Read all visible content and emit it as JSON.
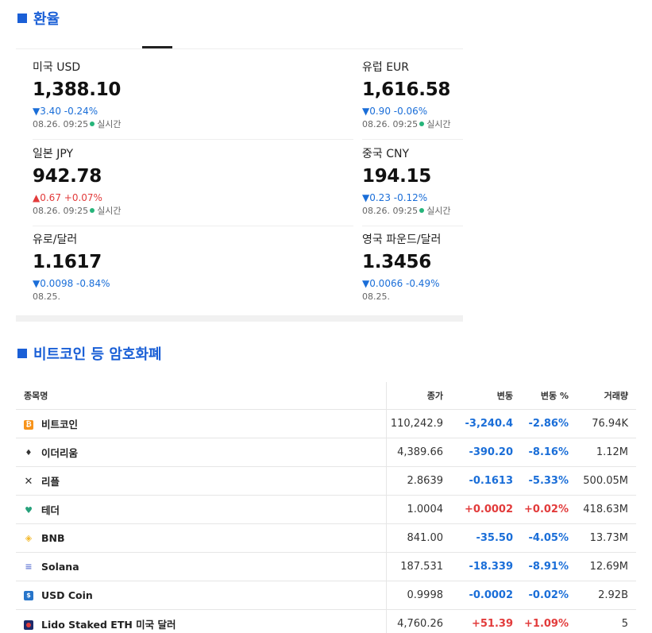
{
  "fx_section": {
    "title": "환율"
  },
  "fx_items": [
    {
      "name": "미국 USD",
      "price": "1,388.10",
      "change": "▼3.40  -0.24%",
      "direction": "down",
      "date": "08.26. 09:25",
      "live": "실시간"
    },
    {
      "name": "유럽 EUR",
      "price": "1,616.58",
      "change": "▼0.90  -0.06%",
      "direction": "down",
      "date": "08.26. 09:25",
      "live": "실시간"
    },
    {
      "name": "일본 JPY",
      "price": "942.78",
      "change": "▲0.67  +0.07%",
      "direction": "up",
      "date": "08.26. 09:25",
      "live": "실시간"
    },
    {
      "name": "중국 CNY",
      "price": "194.15",
      "change": "▼0.23  -0.12%",
      "direction": "down",
      "date": "08.26. 09:25",
      "live": "실시간"
    },
    {
      "name": "유로/달러",
      "price": "1.1617",
      "change": "▼0.0098  -0.84%",
      "direction": "down",
      "date": "08.25.",
      "live": ""
    },
    {
      "name": "영국 파운드/달러",
      "price": "1.3456",
      "change": "▼0.0066  -0.49%",
      "direction": "down",
      "date": "08.25.",
      "live": ""
    }
  ],
  "crypto_section": {
    "title": "비트코인 등 암호화폐"
  },
  "crypto_table": {
    "headers": {
      "name": "종목명",
      "price": "종가",
      "change": "변동",
      "change_pct": "변동 %",
      "volume": "거래량"
    },
    "rows": [
      {
        "icon": "bitcoin-icon",
        "name": "비트코인",
        "price": "110,242.9",
        "change": "-3,240.4",
        "change_pct": "-2.86%",
        "volume": "76.94K",
        "direction": "down"
      },
      {
        "icon": "ethereum-icon",
        "name": "이더리움",
        "price": "4,389.66",
        "change": "-390.20",
        "change_pct": "-8.16%",
        "volume": "1.12M",
        "direction": "down"
      },
      {
        "icon": "xrp-icon",
        "name": "리플",
        "price": "2.8639",
        "change": "-0.1613",
        "change_pct": "-5.33%",
        "volume": "500.05M",
        "direction": "down"
      },
      {
        "icon": "tether-icon",
        "name": "테더",
        "price": "1.0004",
        "change": "+0.0002",
        "change_pct": "+0.02%",
        "volume": "418.63M",
        "direction": "up"
      },
      {
        "icon": "bnb-icon",
        "name": "BNB",
        "price": "841.00",
        "change": "-35.50",
        "change_pct": "-4.05%",
        "volume": "13.73M",
        "direction": "down"
      },
      {
        "icon": "solana-icon",
        "name": "Solana",
        "price": "187.531",
        "change": "-18.339",
        "change_pct": "-8.91%",
        "volume": "12.69M",
        "direction": "down"
      },
      {
        "icon": "usd-coin-icon",
        "name": "USD Coin",
        "price": "0.9998",
        "change": "-0.0002",
        "change_pct": "-0.02%",
        "volume": "2.92B",
        "direction": "down"
      },
      {
        "icon": "steth-icon",
        "name": "Lido Staked ETH 미국 달러",
        "price": "4,760.26",
        "change": "+51.39",
        "change_pct": "+1.09%",
        "volume": "5",
        "direction": "up"
      }
    ]
  },
  "colors": {
    "accent": "#1a5fd6",
    "down": "#1a6ed8",
    "up": "#e23b3b",
    "live_dot": "#26b47a"
  }
}
